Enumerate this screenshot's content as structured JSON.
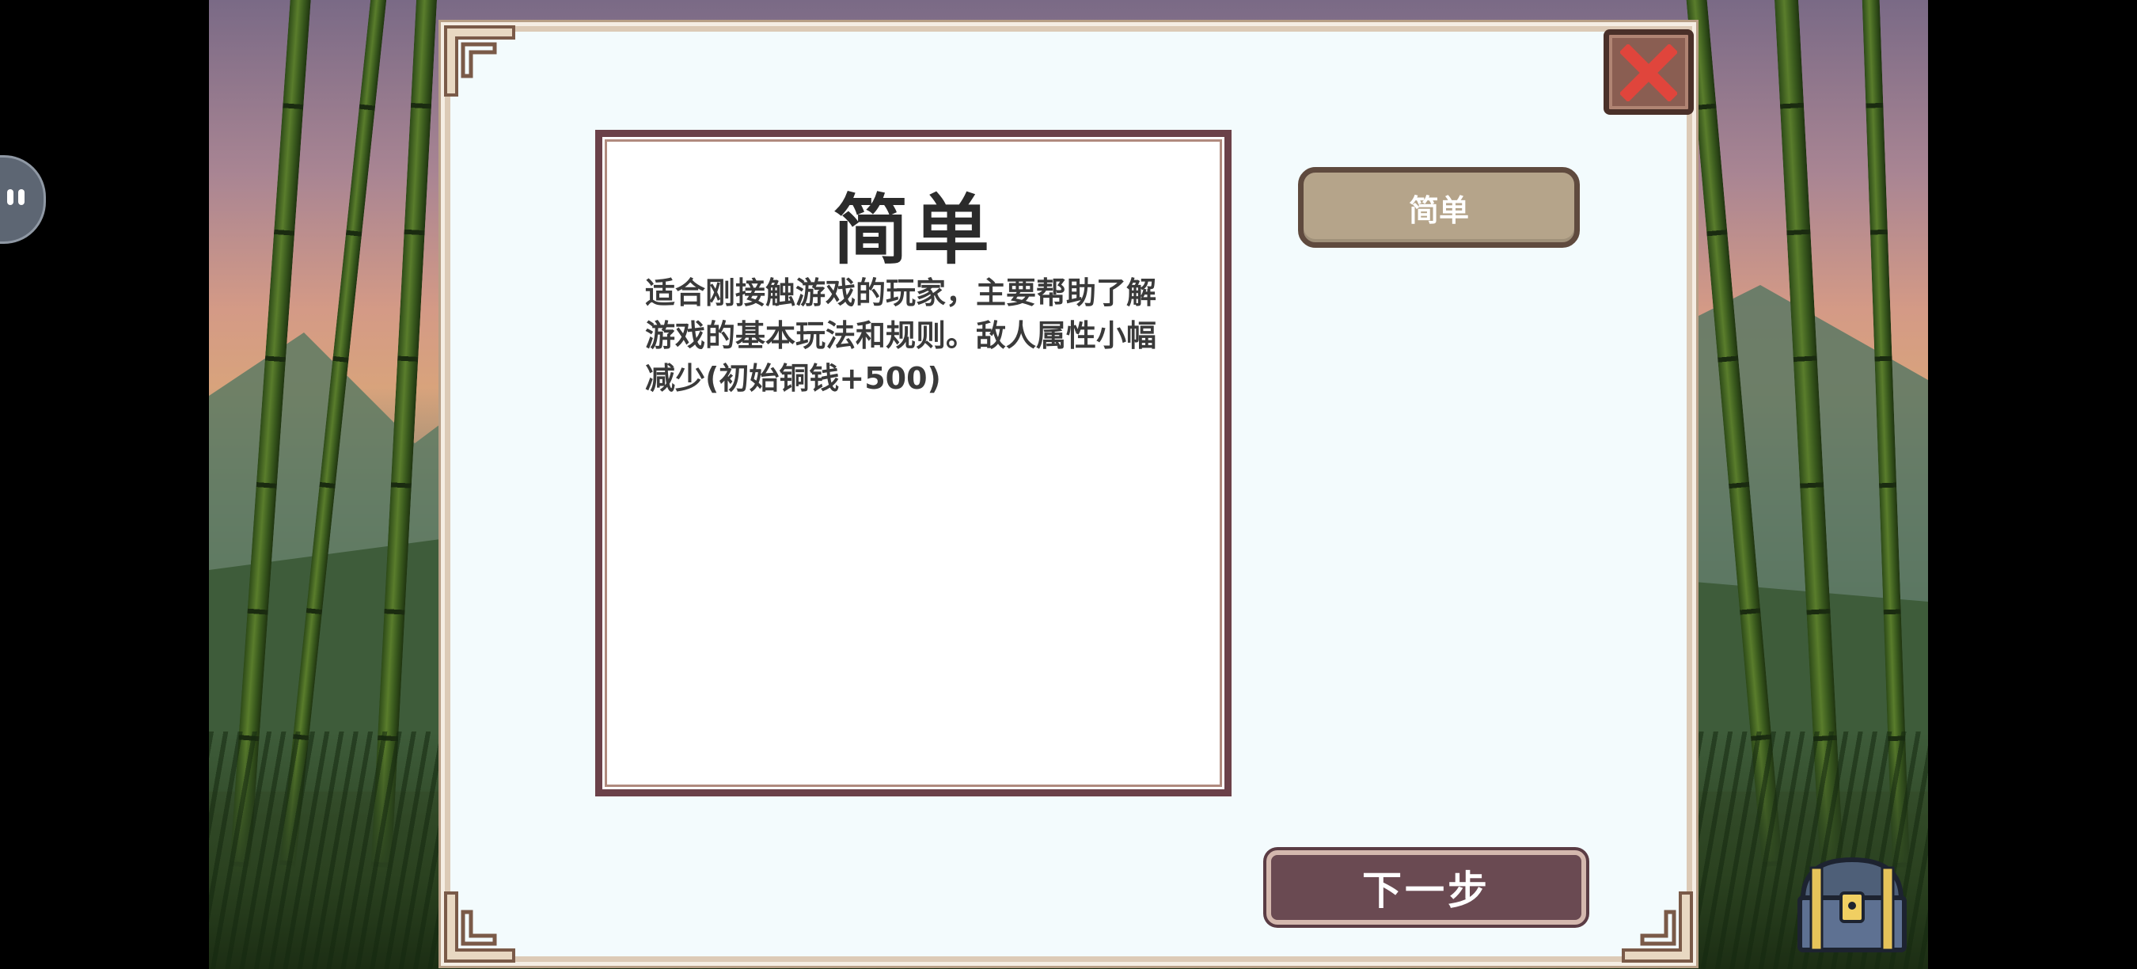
{
  "dialog": {
    "title": "简单",
    "description": "适合刚接触游戏的玩家，主要帮助了解游戏的基本玩法和规则。敌人属性小幅减少(初始铜钱+500)"
  },
  "difficulty_options": [
    {
      "label": "简单",
      "selected": true
    }
  ],
  "buttons": {
    "next_label": "下一步",
    "close_icon": "close-x-icon"
  },
  "icons": {
    "side_pill": "pause-icon",
    "chest": "treasure-chest-icon"
  },
  "colors": {
    "panel_bg": "#f3fbfd",
    "frame_border": "#6b4149",
    "option_selected": "#b5a48a",
    "next_button": "#6a4a52",
    "close_x": "#e0453c"
  }
}
